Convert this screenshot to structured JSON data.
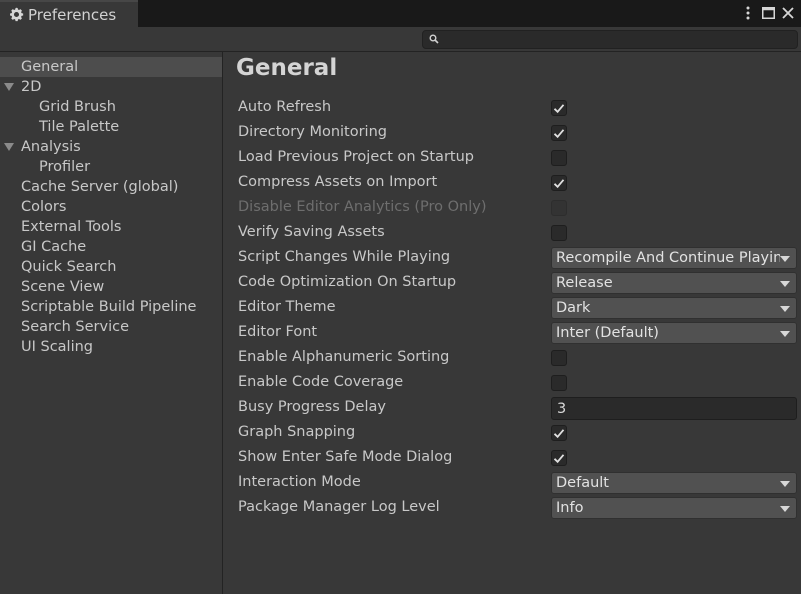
{
  "window": {
    "tab_title": "Preferences",
    "icons": {
      "tab": "gear-icon",
      "menu": "kebab-menu-icon",
      "maximize": "maximize-icon",
      "close": "close-icon"
    }
  },
  "search": {
    "value": "",
    "icon": "search-icon"
  },
  "sidebar": {
    "items": [
      {
        "label": "General",
        "level": 0,
        "selected": true,
        "expandable": false
      },
      {
        "label": "2D",
        "level": 0,
        "selected": false,
        "expandable": true
      },
      {
        "label": "Grid Brush",
        "level": 1,
        "selected": false,
        "expandable": false
      },
      {
        "label": "Tile Palette",
        "level": 1,
        "selected": false,
        "expandable": false
      },
      {
        "label": "Analysis",
        "level": 0,
        "selected": false,
        "expandable": true
      },
      {
        "label": "Profiler",
        "level": 1,
        "selected": false,
        "expandable": false
      },
      {
        "label": "Cache Server (global)",
        "level": 0,
        "selected": false,
        "expandable": false
      },
      {
        "label": "Colors",
        "level": 0,
        "selected": false,
        "expandable": false
      },
      {
        "label": "External Tools",
        "level": 0,
        "selected": false,
        "expandable": false
      },
      {
        "label": "GI Cache",
        "level": 0,
        "selected": false,
        "expandable": false
      },
      {
        "label": "Quick Search",
        "level": 0,
        "selected": false,
        "expandable": false
      },
      {
        "label": "Scene View",
        "level": 0,
        "selected": false,
        "expandable": false
      },
      {
        "label": "Scriptable Build Pipeline",
        "level": 0,
        "selected": false,
        "expandable": false
      },
      {
        "label": "Search Service",
        "level": 0,
        "selected": false,
        "expandable": false
      },
      {
        "label": "UI Scaling",
        "level": 0,
        "selected": false,
        "expandable": false
      }
    ]
  },
  "main": {
    "title": "General",
    "settings": [
      {
        "label": "Auto Refresh",
        "control": "checkbox",
        "checked": true,
        "disabled": false
      },
      {
        "label": "Directory Monitoring",
        "control": "checkbox",
        "checked": true,
        "disabled": false
      },
      {
        "label": "Load Previous Project on Startup",
        "control": "checkbox",
        "checked": false,
        "disabled": false
      },
      {
        "label": "Compress Assets on Import",
        "control": "checkbox",
        "checked": true,
        "disabled": false
      },
      {
        "label": "Disable Editor Analytics (Pro Only)",
        "control": "checkbox",
        "checked": false,
        "disabled": true
      },
      {
        "label": "Verify Saving Assets",
        "control": "checkbox",
        "checked": false,
        "disabled": false
      },
      {
        "label": "Script Changes While Playing",
        "control": "dropdown",
        "value": "Recompile And Continue Playing",
        "disabled": false
      },
      {
        "label": "Code Optimization On Startup",
        "control": "dropdown",
        "value": "Release",
        "disabled": false
      },
      {
        "label": "Editor Theme",
        "control": "dropdown",
        "value": "Dark",
        "disabled": false
      },
      {
        "label": "Editor Font",
        "control": "dropdown",
        "value": "Inter (Default)",
        "disabled": false
      },
      {
        "label": "Enable Alphanumeric Sorting",
        "control": "checkbox",
        "checked": false,
        "disabled": false
      },
      {
        "label": "Enable Code Coverage",
        "control": "checkbox",
        "checked": false,
        "disabled": false
      },
      {
        "label": "Busy Progress Delay",
        "control": "text",
        "value": "3",
        "disabled": false
      },
      {
        "label": "Graph Snapping",
        "control": "checkbox",
        "checked": true,
        "disabled": false
      },
      {
        "label": "Show Enter Safe Mode Dialog",
        "control": "checkbox",
        "checked": true,
        "disabled": false
      },
      {
        "label": "Interaction Mode",
        "control": "dropdown",
        "value": "Default",
        "disabled": false
      },
      {
        "label": "Package Manager Log Level",
        "control": "dropdown",
        "value": "Info",
        "disabled": false
      }
    ]
  },
  "colors": {
    "background": "#383838",
    "tabstrip": "#191919",
    "selection": "#4d4d4d",
    "field": "#2a2a2a",
    "dropdown": "#515151"
  }
}
